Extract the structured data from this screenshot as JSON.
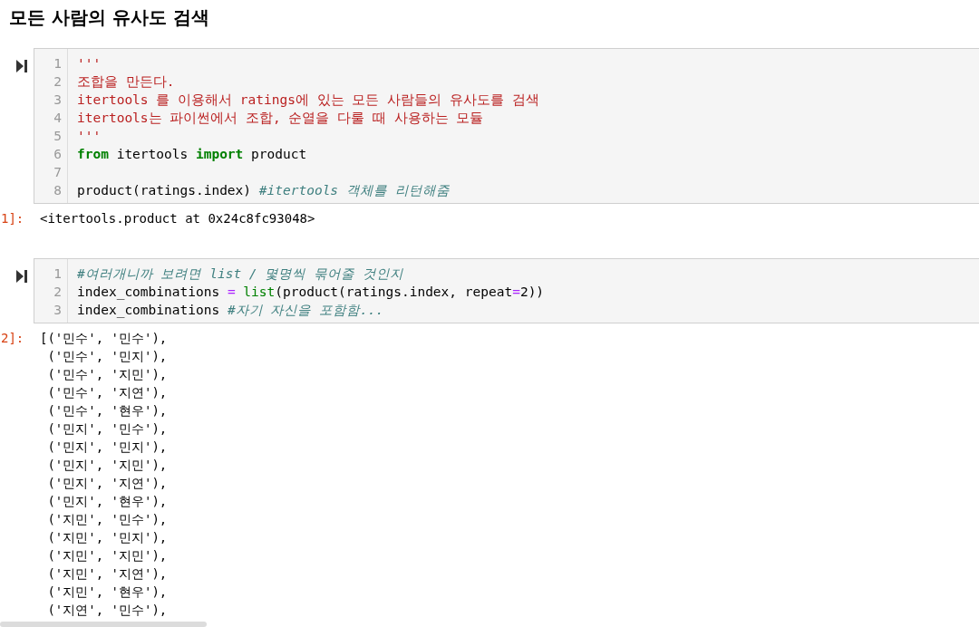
{
  "heading": "모든 사람의 유사도 검색",
  "cells": [
    {
      "output_prompt": "1]:",
      "code": [
        {
          "number": "1",
          "tokens": [
            {
              "kind": "string",
              "text": "'''"
            }
          ]
        },
        {
          "number": "2",
          "tokens": [
            {
              "kind": "string",
              "text": "조합을 만든다."
            }
          ]
        },
        {
          "number": "3",
          "tokens": [
            {
              "kind": "string",
              "text": "itertools 를 이용해서 ratings에 있는 모든 사람들의 유사도를 검색"
            }
          ]
        },
        {
          "number": "4",
          "tokens": [
            {
              "kind": "string",
              "text": "itertools는 파이썬에서 조합, 순열을 다룰 때 사용하는 모듈"
            }
          ]
        },
        {
          "number": "5",
          "tokens": [
            {
              "kind": "string",
              "text": "'''"
            }
          ]
        },
        {
          "number": "6",
          "tokens": [
            {
              "kind": "keyword",
              "text": "from"
            },
            {
              "kind": "name",
              "text": " itertools "
            },
            {
              "kind": "keyword",
              "text": "import"
            },
            {
              "kind": "name",
              "text": " product"
            }
          ]
        },
        {
          "number": "7"
        },
        {
          "number": "8",
          "tokens": [
            {
              "kind": "name",
              "text": "product(ratings.index) "
            },
            {
              "kind": "comment",
              "text": "#itertools 객체를 리턴해줌"
            }
          ]
        }
      ],
      "output": [
        "<itertools.product at 0x24c8fc93048>"
      ]
    },
    {
      "output_prompt": "2]:",
      "code": [
        {
          "number": "1",
          "tokens": [
            {
              "kind": "comment",
              "text": "#여러개니까 보려면 list / 몇명씩 묶어줄 것인지"
            }
          ]
        },
        {
          "number": "2",
          "tokens": [
            {
              "kind": "name",
              "text": "index_combinations "
            },
            {
              "kind": "operator",
              "text": "="
            },
            {
              "kind": "builtin",
              "text": " list"
            },
            {
              "kind": "name",
              "text": "(product(ratings.index, repeat"
            },
            {
              "kind": "operator",
              "text": "="
            },
            {
              "kind": "name",
              "text": "2))"
            }
          ]
        },
        {
          "number": "3",
          "tokens": [
            {
              "kind": "name",
              "text": "index_combinations "
            },
            {
              "kind": "comment",
              "text": "#자기 자신을 포함함..."
            }
          ]
        }
      ],
      "output": [
        "[('민수', '민수'),",
        " ('민수', '민지'),",
        " ('민수', '지민'),",
        " ('민수', '지연'),",
        " ('민수', '현우'),",
        " ('민지', '민수'),",
        " ('민지', '민지'),",
        " ('민지', '지민'),",
        " ('민지', '지연'),",
        " ('민지', '현우'),",
        " ('지민', '민수'),",
        " ('지민', '민지'),",
        " ('지민', '지민'),",
        " ('지민', '지연'),",
        " ('지민', '현우'),",
        " ('지연', '민수'),"
      ]
    }
  ]
}
